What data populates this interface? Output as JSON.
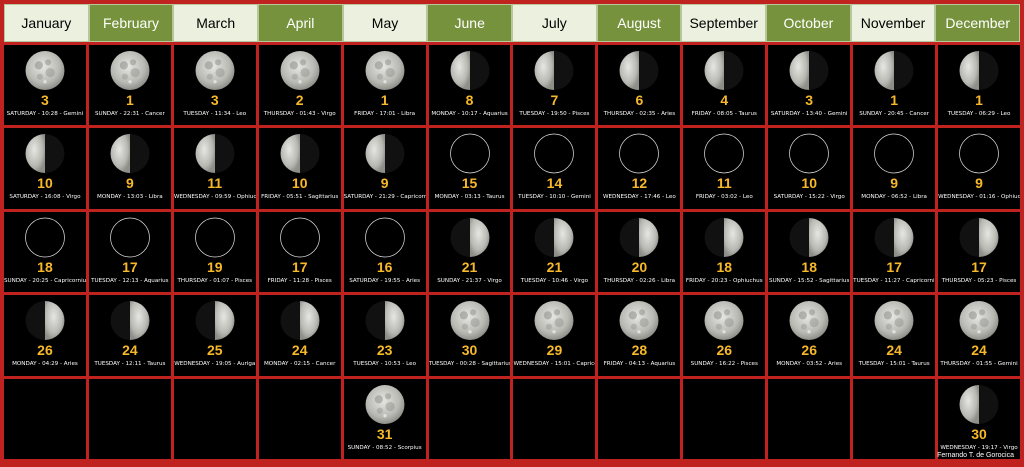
{
  "months": [
    "January",
    "February",
    "March",
    "April",
    "May",
    "June",
    "July",
    "August",
    "September",
    "October",
    "November",
    "December"
  ],
  "credit": "Fernando T. de Gorocica",
  "colors": {
    "header_light": "#ebf1de",
    "header_dark": "#76923c",
    "border": "#c0231f",
    "day_number": "#f7b82a"
  },
  "columns": [
    [
      {
        "phase": "full",
        "day": "3",
        "info": "SATURDAY - 10:28 - Gemini"
      },
      {
        "phase": "third",
        "day": "10",
        "info": "SATURDAY - 16:08 - Virgo"
      },
      {
        "phase": "new",
        "day": "18",
        "info": "SUNDAY - 20:25 - Capricornius"
      },
      {
        "phase": "first",
        "day": "26",
        "info": "MONDAY - 04:29 - Aries"
      },
      null
    ],
    [
      {
        "phase": "full",
        "day": "1",
        "info": "SUNDAY - 22:31 - Cancer"
      },
      {
        "phase": "third",
        "day": "9",
        "info": "MONDAY - 13:03 - Libra"
      },
      {
        "phase": "new",
        "day": "17",
        "info": "TUESDAY - 12:13 - Aquarius"
      },
      {
        "phase": "first",
        "day": "24",
        "info": "TUESDAY - 12:11 - Taurus"
      },
      null
    ],
    [
      {
        "phase": "full",
        "day": "3",
        "info": "TUESDAY - 11:34 - Leo"
      },
      {
        "phase": "third",
        "day": "11",
        "info": "WEDNESDAY - 09:59 - Ophiuchus"
      },
      {
        "phase": "new",
        "day": "19",
        "info": "THURSDAY - 01:07 - Pisces"
      },
      {
        "phase": "first",
        "day": "25",
        "info": "WEDNESDAY - 19:05 - Auriga"
      },
      null
    ],
    [
      {
        "phase": "full",
        "day": "2",
        "info": "THURSDAY - 01:43 - Virgo"
      },
      {
        "phase": "third",
        "day": "10",
        "info": "FRIDAY - 05:51 - Sagittarius"
      },
      {
        "phase": "new",
        "day": "17",
        "info": "FRIDAY - 11:28 - Pisces"
      },
      {
        "phase": "first",
        "day": "24",
        "info": "MONDAY - 02:15 - Cancer"
      },
      null
    ],
    [
      {
        "phase": "full",
        "day": "1",
        "info": "FRIDAY - 17:01 - Libra"
      },
      {
        "phase": "third",
        "day": "9",
        "info": "SATURDAY - 21:29 - Capricornius"
      },
      {
        "phase": "new",
        "day": "16",
        "info": "SATURDAY - 19:55 - Aries"
      },
      {
        "phase": "first",
        "day": "23",
        "info": "TUESDAY - 10:53 - Leo"
      },
      {
        "phase": "full",
        "day": "31",
        "info": "SUNDAY - 08:52 - Scorpius"
      }
    ],
    [
      {
        "phase": "third",
        "day": "8",
        "info": "MONDAY - 10:17 - Aquarius"
      },
      {
        "phase": "new",
        "day": "15",
        "info": "MONDAY - 03:13 - Taurus"
      },
      {
        "phase": "first",
        "day": "21",
        "info": "SUNDAY - 21:37 - Virgo"
      },
      {
        "phase": "full",
        "day": "30",
        "info": "TUESDAY - 00:28 - Sagittarius"
      },
      null
    ],
    [
      {
        "phase": "third",
        "day": "7",
        "info": "TUESDAY - 19:50 - Pisces"
      },
      {
        "phase": "new",
        "day": "14",
        "info": "TUESDAY - 10:10 - Gemini"
      },
      {
        "phase": "first",
        "day": "21",
        "info": "TUESDAY - 10:46 - Virgo"
      },
      {
        "phase": "full",
        "day": "29",
        "info": "WEDNESDAY - 15:01 - Capricornius"
      },
      null
    ],
    [
      {
        "phase": "third",
        "day": "6",
        "info": "THURSDAY - 02:35 - Aries"
      },
      {
        "phase": "new",
        "day": "12",
        "info": "WEDNESDAY - 17:46 - Leo"
      },
      {
        "phase": "first",
        "day": "20",
        "info": "THURSDAY - 02:26 - Libra"
      },
      {
        "phase": "full",
        "day": "28",
        "info": "FRIDAY - 04:13 - Aquarius"
      },
      null
    ],
    [
      {
        "phase": "third",
        "day": "4",
        "info": "FRIDAY - 08:05 - Taurus"
      },
      {
        "phase": "new",
        "day": "11",
        "info": "FRIDAY - 03:02 - Leo"
      },
      {
        "phase": "first",
        "day": "18",
        "info": "FRIDAY - 20:23 - Ophiuchus"
      },
      {
        "phase": "full",
        "day": "26",
        "info": "SUNDAY - 16:22 - Pisces"
      },
      null
    ],
    [
      {
        "phase": "third",
        "day": "3",
        "info": "SATURDAY - 13:40 - Gemini"
      },
      {
        "phase": "new",
        "day": "10",
        "info": "SATURDAY - 15:22 - Virgo"
      },
      {
        "phase": "first",
        "day": "18",
        "info": "SUNDAY - 15:52 - Sagittarius"
      },
      {
        "phase": "full",
        "day": "26",
        "info": "MONDAY - 03:52 - Aries"
      },
      null
    ],
    [
      {
        "phase": "third",
        "day": "1",
        "info": "SUNDAY - 20:45 - Cancer"
      },
      {
        "phase": "new",
        "day": "9",
        "info": "MONDAY - 06:52 - Libra"
      },
      {
        "phase": "first",
        "day": "17",
        "info": "TUESDAY - 11:27 - Capricornius"
      },
      {
        "phase": "full",
        "day": "24",
        "info": "TUESDAY - 15:01 - Taurus"
      },
      null
    ],
    [
      {
        "phase": "third",
        "day": "1",
        "info": "TUESDAY - 06:29 - Leo"
      },
      {
        "phase": "new",
        "day": "9",
        "info": "WEDNESDAY - 01:16 - Ophiuchus"
      },
      {
        "phase": "first",
        "day": "17",
        "info": "THURSDAY - 05:23 - Pisces"
      },
      {
        "phase": "full",
        "day": "24",
        "info": "THURSDAY - 01:55 - Gemini"
      },
      {
        "phase": "third",
        "day": "30",
        "info": "WEDNESDAY - 19:17 - Virgo"
      }
    ]
  ]
}
